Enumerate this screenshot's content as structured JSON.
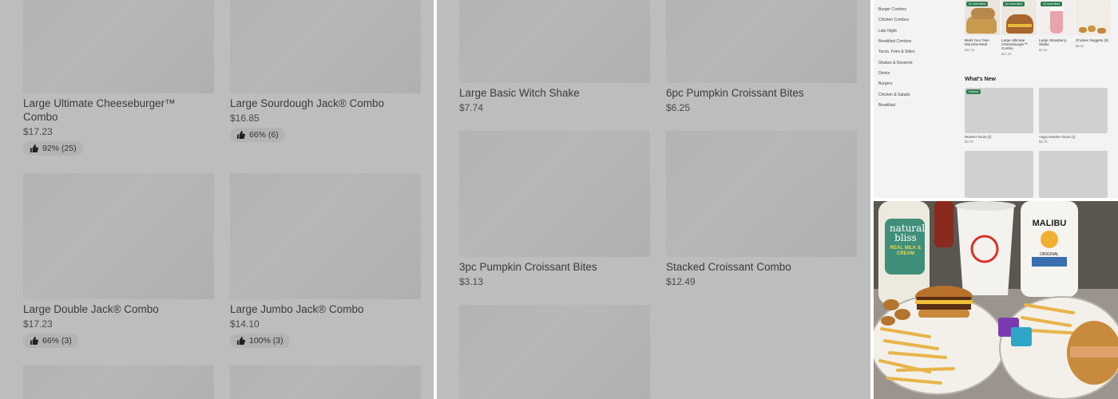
{
  "panel1": {
    "items": [
      {
        "name": "Large Ultimate Cheeseburger™ Combo",
        "price": "$17.23",
        "rating": "92% (25)"
      },
      {
        "name": "Large Sourdough Jack® Combo",
        "price": "$16.85",
        "rating": "66% (6)"
      },
      {
        "name": "Large Double Jack® Combo",
        "price": "$17.23",
        "rating": "66% (3)"
      },
      {
        "name": "Large Jumbo Jack®  Combo",
        "price": "$14.10",
        "rating": "100% (3)"
      }
    ]
  },
  "panel2": {
    "items": [
      {
        "name": "Large Basic Witch Shake",
        "price": "$7.74"
      },
      {
        "name": "6pc Pumpkin Croissant Bites",
        "price": "$6.25"
      },
      {
        "name": "3pc Pumpkin Croissant Bites",
        "price": "$3.13"
      },
      {
        "name": "Stacked Croissant Combo",
        "price": "$12.49"
      }
    ]
  },
  "panel3": {
    "categories": [
      "Burger Combos",
      "Chicken Combos",
      "Late Night",
      "Breakfast Combos",
      "Tacos, Fries & Sides",
      "Shakes & Desserts",
      "Drinks",
      "Burgers",
      "Chicken & Salads",
      "Breakfast"
    ],
    "featured": [
      {
        "badge": "#1 most liked",
        "name": "Build Your Own Munchie Meal",
        "price": "$12.75"
      },
      {
        "badge": "#2 most liked",
        "name": "Large Ultimate Cheeseburger™ Combo",
        "price": "$17.23"
      },
      {
        "badge": "#3 most liked",
        "name": "Large Strawberry Shake",
        "price": "$7.49"
      },
      {
        "badge": "",
        "name": "Chicken Nuggets (8)",
        "price": "$6.00"
      }
    ],
    "whats_new_title": "What's New",
    "new_items": [
      {
        "badge": "Popular",
        "name": "Monster Tacos (2)",
        "price": "$3.75"
      },
      {
        "badge": "",
        "name": "Angry Monster Tacos (2)",
        "price": "$3.75"
      }
    ]
  },
  "photo": {
    "bottle_left_text": "natural bliss",
    "bottle_left_sub": "REAL MILK & CREAM",
    "bottle_right_text": "MALIBU",
    "bottle_right_sub": "ORIGINAL"
  },
  "colors": {
    "overlay": "#bdbdbd",
    "badge_green": "#2e7d4f"
  }
}
